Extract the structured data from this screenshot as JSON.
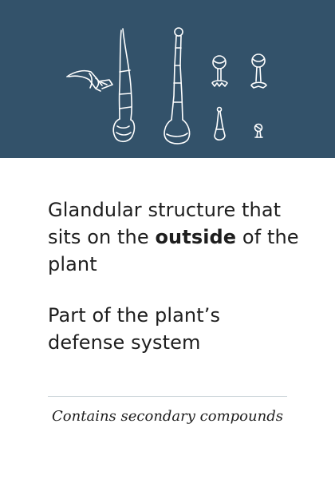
{
  "illustration": {
    "icon": "trichome-illustration",
    "background_color": "#33526a",
    "line_color": "#ffffff"
  },
  "description": {
    "line1_prefix": "Glandular structure that sits on the ",
    "line1_emphasis": "outside",
    "line1_suffix": " of the plant",
    "line2": "Part of the plant’s defense system"
  },
  "footer": {
    "note": "Contains secondary compounds"
  }
}
